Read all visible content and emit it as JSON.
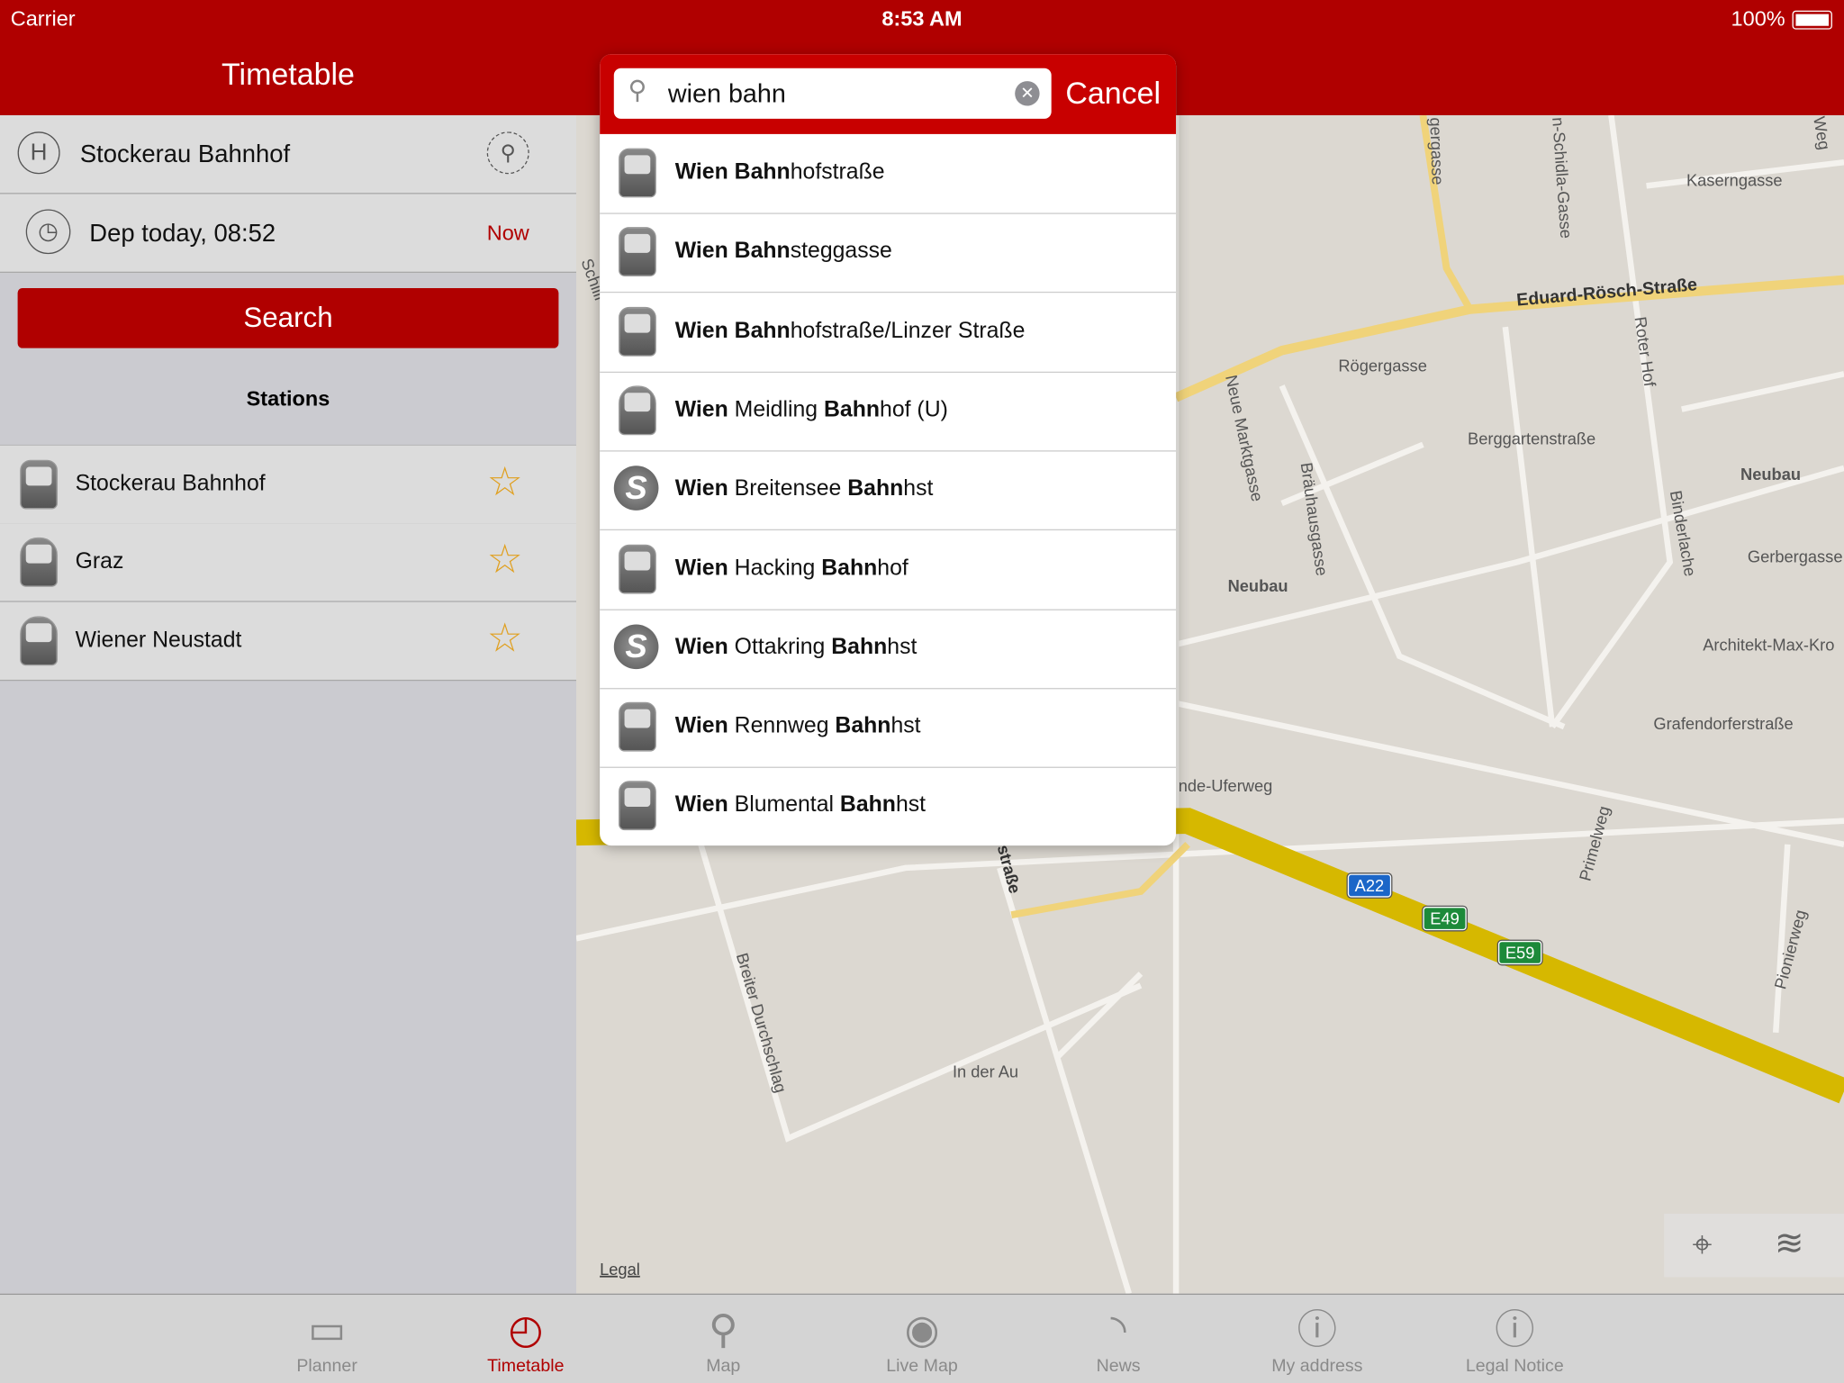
{
  "status_bar": {
    "carrier": "Carrier",
    "time": "8:53 AM",
    "battery": "100%"
  },
  "sidebar": {
    "title": "Timetable",
    "from_station": "Stockerau Bahnhof",
    "departure": "Dep today, 08:52",
    "now_label": "Now",
    "search_label": "Search",
    "stations_heading": "Stations",
    "stations": [
      {
        "name": "Stockerau Bahnhof",
        "icon": "train-icon"
      },
      {
        "name": "Graz",
        "icon": "highspeed-train-icon"
      },
      {
        "name": "Wiener Neustadt",
        "icon": "highspeed-train-icon"
      }
    ]
  },
  "search": {
    "query": "wien bahn",
    "cancel_label": "Cancel",
    "results": [
      {
        "bold": "Wien Bahn",
        "rest": "hofstraße",
        "icon": "tram-icon"
      },
      {
        "bold": "Wien Bahn",
        "rest": "steggasse",
        "icon": "tram-icon"
      },
      {
        "bold": "Wien Bahn",
        "rest": "hofstraße/Linzer Straße",
        "icon": "tram-icon"
      },
      {
        "bold": "Wien",
        "mid": " Meidling ",
        "bold2": "Bahn",
        "rest": "hof (U)",
        "icon": "highspeed-train-icon"
      },
      {
        "bold": "Wien",
        "mid": " Breitensee ",
        "bold2": "Bahn",
        "rest": "hst",
        "icon": "s-bahn-icon"
      },
      {
        "bold": "Wien",
        "mid": " Hacking ",
        "bold2": "Bahn",
        "rest": "hof",
        "icon": "train-icon"
      },
      {
        "bold": "Wien",
        "mid": " Ottakring ",
        "bold2": "Bahn",
        "rest": "hst",
        "icon": "s-bahn-icon"
      },
      {
        "bold": "Wien",
        "mid": " Rennweg ",
        "bold2": "Bahn",
        "rest": "hst",
        "icon": "tram-icon"
      },
      {
        "bold": "Wien",
        "mid": " Blumental ",
        "bold2": "Bahn",
        "rest": "hst",
        "icon": "tram-icon"
      }
    ]
  },
  "map": {
    "legal": "Legal",
    "labels": [
      "Kaserngasse",
      "Eduard-Rösch-Straße",
      "Rögergasse",
      "Roter Hof",
      "Berggartenstraße",
      "Neubau",
      "Neubau",
      "Gerbergasse",
      "Architekt-Max-Kro",
      "Grafendorferstraße",
      "Neue Marktgasse",
      "Bräuhausgasse",
      "Binderlache",
      "nde-Uferweg",
      "Primelweg",
      "Pionierweg",
      "Breiter Durchschlag",
      "In der Au",
      "straße",
      "n-Schidla-Gasse",
      "gergasse",
      "Weg",
      "Schilli"
    ],
    "shields": [
      "A22",
      "E49",
      "E59"
    ]
  },
  "tabs": [
    {
      "label": "Planner",
      "icon": "planner-icon",
      "active": false
    },
    {
      "label": "Timetable",
      "icon": "timetable-icon",
      "active": true
    },
    {
      "label": "Map",
      "icon": "map-pin-icon",
      "active": false
    },
    {
      "label": "Live Map",
      "icon": "live-map-icon",
      "active": false
    },
    {
      "label": "News",
      "icon": "rss-icon",
      "active": false
    },
    {
      "label": "My address",
      "icon": "info-italic-icon",
      "active": false
    },
    {
      "label": "Legal Notice",
      "icon": "info-icon",
      "active": false
    }
  ],
  "colors": {
    "brand": "#b00000",
    "star": "#e0a020"
  }
}
